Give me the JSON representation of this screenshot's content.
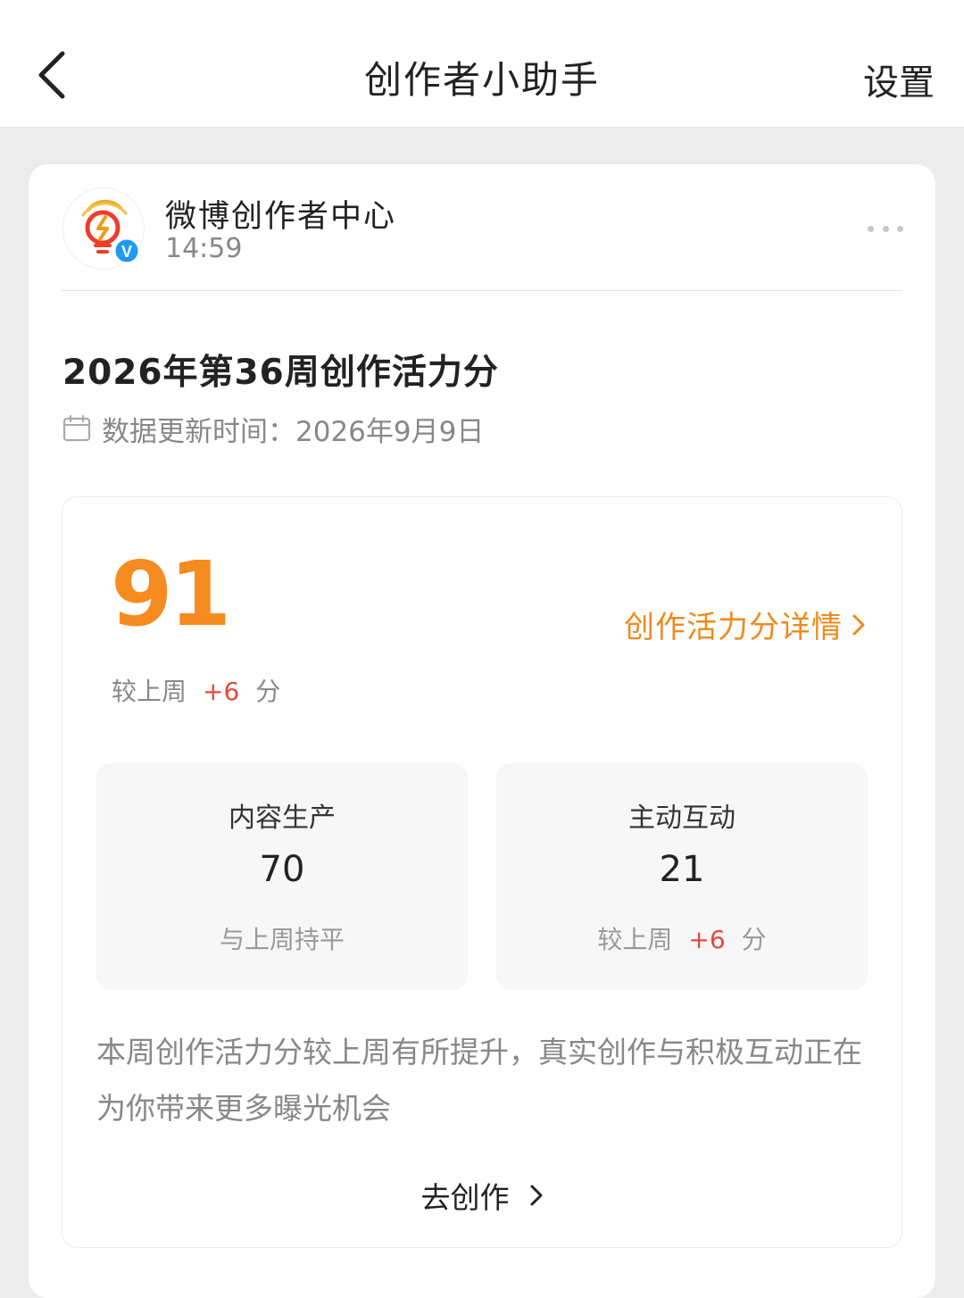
{
  "header": {
    "title": "创作者小助手",
    "settings_label": "设置"
  },
  "message": {
    "sender_name": "微博创作者中心",
    "time": "14:59",
    "verified_badge": "V"
  },
  "report": {
    "title": "2026年第36周创作活力分",
    "update_time": "数据更新时间：2026年9月9日",
    "score": "91",
    "detail_link": "创作活力分详情",
    "compare_prefix": "较上周",
    "compare_delta": "+6",
    "compare_suffix": "分",
    "metrics": [
      {
        "label": "内容生产",
        "value": "70",
        "note": "与上周持平"
      },
      {
        "label": "主动互动",
        "value": "21",
        "note_prefix": "较上周",
        "note_delta": "+6",
        "note_suffix": "分"
      }
    ],
    "summary": "本周创作活力分较上周有所提升，真实创作与积极互动正在为你带来更多曝光机会",
    "cta": "去创作"
  },
  "colors": {
    "accent_orange": "#f68b1f",
    "delta_red": "#e24b3b",
    "verified_blue": "#1d9bf0"
  },
  "icons": [
    "back-arrow-icon",
    "more-dots-icon",
    "calendar-icon",
    "chevron-right-icon",
    "lightbulb-logo-icon"
  ]
}
